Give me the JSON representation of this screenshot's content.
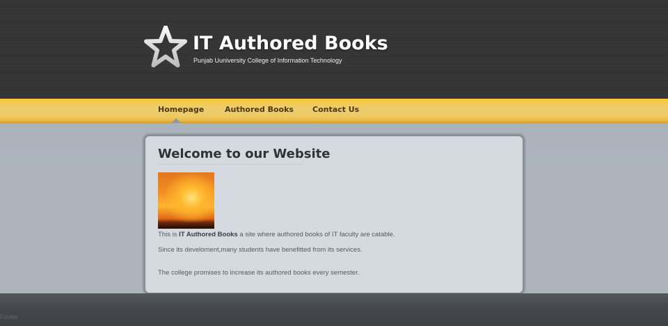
{
  "header": {
    "logo_icon": "star-icon",
    "title": "IT Authored Books",
    "subtitle": "Punjab Uuniversity College of Information Technology"
  },
  "nav": {
    "items": [
      {
        "label": "Homepage",
        "active": true
      },
      {
        "label": "Authored Books",
        "active": false
      },
      {
        "label": "Contact Us",
        "active": false
      }
    ]
  },
  "main": {
    "heading": "Welcome to our Website",
    "image_icon": "fire-image",
    "paragraph1": {
      "before": "This is ",
      "bold": "IT Authored Books",
      "after": " a site where authored books of IT faculty are catable."
    },
    "paragraph2": "Since its develoment,many students have benefitted from its services.",
    "paragraph3": "The college promises to increase its authored books every semester."
  },
  "footer": {
    "text": "Footer"
  },
  "colors": {
    "nav_bar": "#f2c94b",
    "header_bg": "#343434",
    "content_bg": "#d5dae0"
  }
}
